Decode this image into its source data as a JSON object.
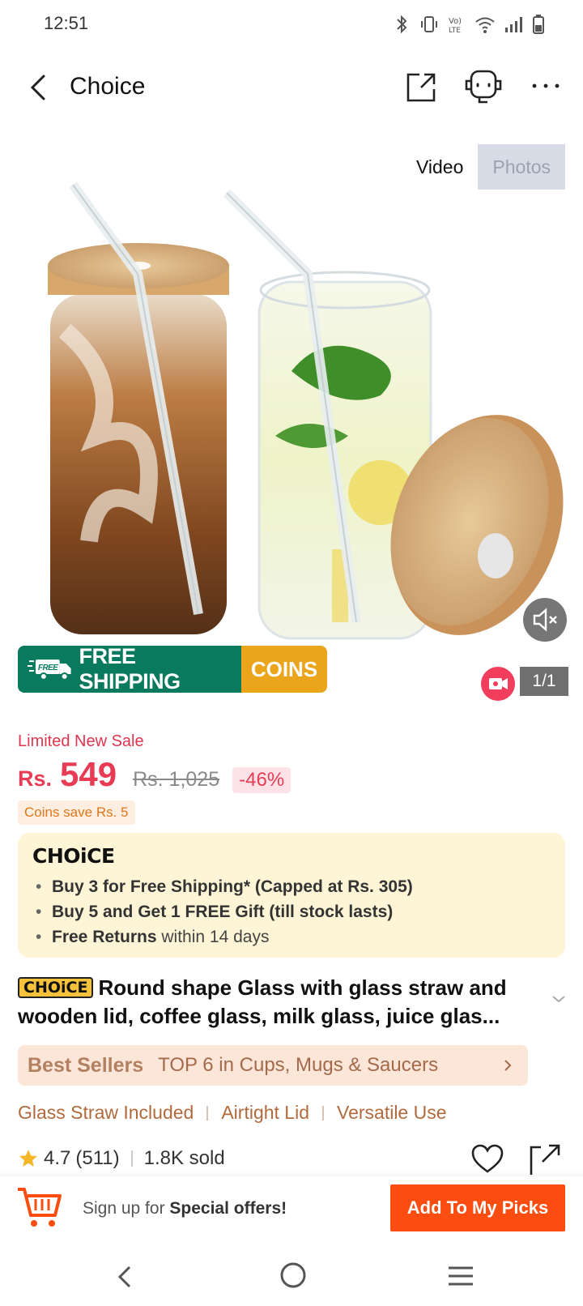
{
  "status_bar": {
    "time": "12:51"
  },
  "nav": {
    "title": "Choice"
  },
  "media": {
    "tab_video": "Video",
    "tab_photos": "Photos",
    "counter": "1/1"
  },
  "free_shipping": {
    "label": "FREE SHIPPING",
    "coins": "COINS",
    "truck_badge": "FREE"
  },
  "price": {
    "sale_label": "Limited New Sale",
    "currency": "Rs.",
    "current": "549",
    "original": "Rs. 1,025",
    "discount": "-46%",
    "coins_save": "Coins save Rs. 5"
  },
  "choice_box": {
    "logo": "CHOiCE",
    "bullets": [
      {
        "bold": "Buy 3 for  Free Shipping* (Capped at Rs. 305)",
        "rest": ""
      },
      {
        "bold": "Buy 5 and Get 1 FREE Gift (till stock lasts)",
        "rest": ""
      },
      {
        "bold": "Free Returns",
        "rest": " within 14 days"
      }
    ]
  },
  "product": {
    "badge": "CHOiCE",
    "title": "Round shape Glass with glass straw and wooden lid, coffee glass, milk glass, juice glas..."
  },
  "best_sellers": {
    "label": "Best Sellers",
    "rank": "TOP 6 in Cups, Mugs & Saucers"
  },
  "tags": [
    "Glass Straw Included",
    "Airtight Lid",
    "Versatile Use"
  ],
  "rating": {
    "score": "4.7",
    "count": "(511)",
    "sold": "1.8K sold"
  },
  "bottom_bar": {
    "signup_prefix": "Sign up for ",
    "signup_bold": "Special offers!",
    "picks_button": "Add To My Picks"
  },
  "colors": {
    "accent_red": "#e83b54",
    "free_ship_green": "#0a7a5e",
    "coins_orange": "#eba51a",
    "cta_orange": "#fa4d0f",
    "choice_bg": "#fef4d6"
  }
}
